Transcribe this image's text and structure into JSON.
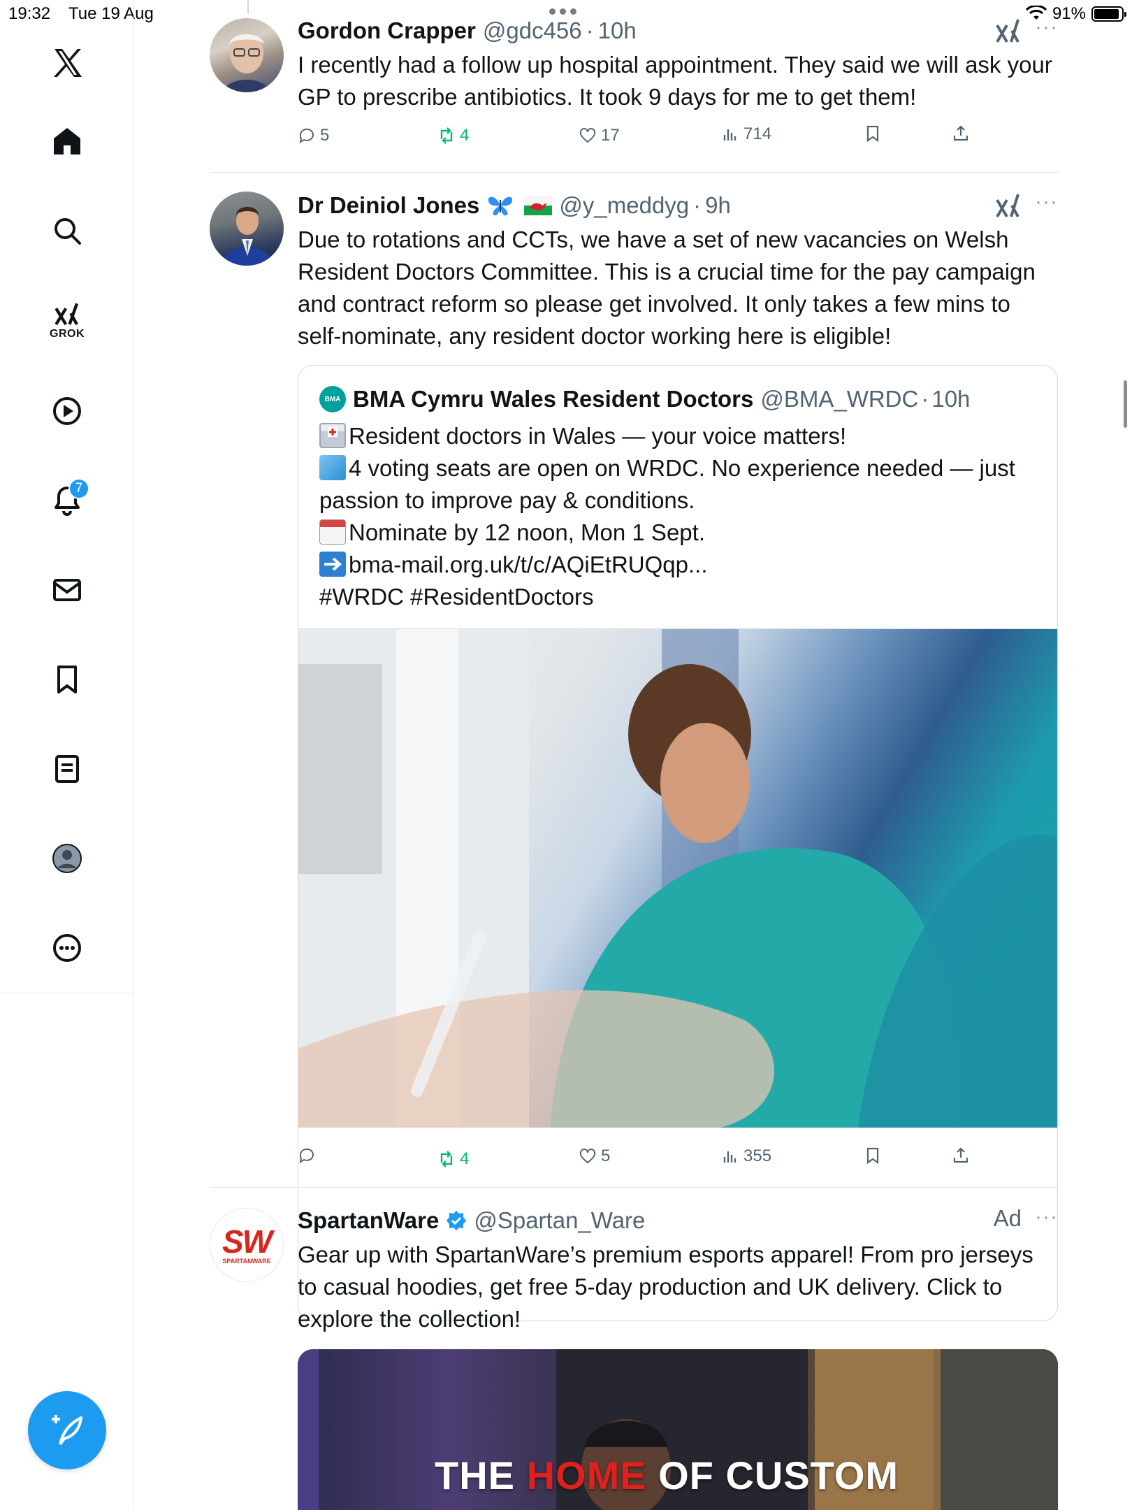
{
  "status_bar": {
    "time": "19:32",
    "date": "Tue 19 Aug",
    "battery": "91%",
    "battery_level": 0.91
  },
  "sidebar": {
    "items": [
      {
        "name": "x-logo"
      },
      {
        "name": "home"
      },
      {
        "name": "search"
      },
      {
        "name": "grok",
        "label": "GROK"
      },
      {
        "name": "video"
      },
      {
        "name": "notifications",
        "badge": "7"
      },
      {
        "name": "messages"
      },
      {
        "name": "bookmarks"
      },
      {
        "name": "lists"
      },
      {
        "name": "profile"
      },
      {
        "name": "more"
      }
    ],
    "accent": "#1d9bf0"
  },
  "tweets": [
    {
      "name": "Gordon Crapper",
      "handle": "@gdc456",
      "time": "10h",
      "text": "I recently had a follow up hospital appointment.  They said we will ask your GP to prescribe antibiotics.  It took 9 days for me to get them!",
      "replies": "5",
      "retweets": "4",
      "likes": "17",
      "views": "714"
    },
    {
      "name": "Dr Deiniol Jones",
      "handle": "@y_meddyg",
      "time": "9h",
      "text": "Due to rotations and CCTs, we have a set of new vacancies on Welsh Resident Doctors Committee. This is a crucial time for the pay campaign and contract reform so please get involved. It only takes a few mins to self-nominate, any resident doctor working here is eligible!",
      "replies": "",
      "retweets": "4",
      "likes": "5",
      "views": "355",
      "quote": {
        "avatar_text": "BMA",
        "name": "BMA Cymru Wales Resident Doctors",
        "handle": "@BMA_WRDC",
        "time": "10h",
        "lines": [
          "Resident doctors in Wales — your voice matters!",
          "4 voting seats are open on WRDC. No experience needed — just",
          "passion to improve pay & conditions.",
          "Nominate by 12 noon, Mon 1 Sept.",
          "bma-mail.org.uk/t/c/AQiEtRUQqp...",
          "#WRDC #ResidentDoctors"
        ]
      }
    },
    {
      "name": "SpartanWare",
      "handle": "@Spartan_Ware",
      "ad_label": "Ad",
      "avatar_text": "SW",
      "avatar_sub": "SPARTANWARE",
      "text": "Gear up with SpartanWare’s premium esports apparel! From pro jerseys to casual hoodies, get free 5-day production and UK delivery. Click to explore the collection!",
      "image_caption": {
        "part1": "THE ",
        "highlight": "HOME",
        "part2": " OF CUSTOM"
      }
    }
  ],
  "colors": {
    "verified": "#1d9bf0",
    "retweet": "#00ba7c",
    "muted": "#536471"
  }
}
